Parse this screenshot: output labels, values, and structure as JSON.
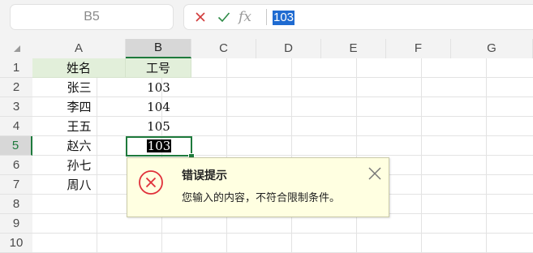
{
  "formula_bar": {
    "name_box": "B5",
    "fx_label": "fx",
    "value": "103"
  },
  "sheet": {
    "columns": [
      "A",
      "B",
      "C",
      "D",
      "E",
      "F",
      "G"
    ],
    "selected_column": "B",
    "rows": [
      "1",
      "2",
      "3",
      "4",
      "5",
      "6",
      "7",
      "8",
      "9",
      "10"
    ],
    "selected_row": "5",
    "cells": {
      "A1": "姓名",
      "B1": "工号",
      "A2": "张三",
      "B2": "103",
      "A3": "李四",
      "B3": "104",
      "A4": "王五",
      "B4": "105",
      "A5": "赵六",
      "B5": "103",
      "A6": "孙七",
      "A7": "周八"
    },
    "header_fill_color": "#e2efda",
    "selection_color": "#1e7a3c"
  },
  "error_dialog": {
    "title": "错误提示",
    "message": "您输入的内容，不符合限制条件。",
    "icon": "error-circle-x-icon",
    "icon_color": "#e0303a",
    "background_color": "#ffffe1"
  }
}
